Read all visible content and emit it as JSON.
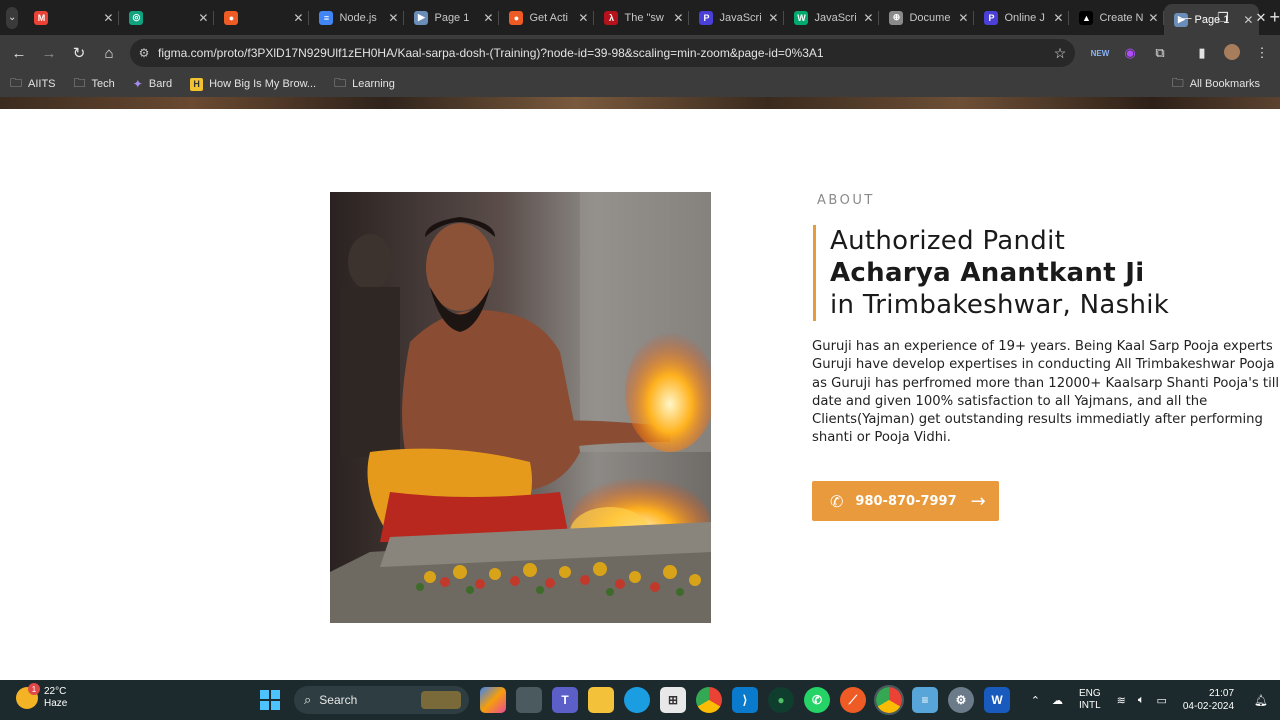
{
  "browser": {
    "tabs": [
      {
        "title": "",
        "icon": "gmail-icon",
        "color": "#ea4335",
        "glyph": "M"
      },
      {
        "title": "",
        "icon": "chatgpt-icon",
        "color": "#10a37f",
        "glyph": "◎"
      },
      {
        "title": "",
        "icon": "postman-icon",
        "color": "#ef5b25",
        "glyph": "●"
      },
      {
        "title": "Node.js",
        "icon": "docs-icon",
        "color": "#4285f4",
        "glyph": "≡"
      },
      {
        "title": "Page 1",
        "icon": "figma-play-icon",
        "color": "#6b8eb8",
        "glyph": "▶"
      },
      {
        "title": "Get Acti",
        "icon": "postman-icon",
        "color": "#ef5b25",
        "glyph": "●"
      },
      {
        "title": "The \"sw",
        "icon": "w3-icon",
        "color": "#b5121b",
        "glyph": "λ"
      },
      {
        "title": "JavaScri",
        "icon": "js-icon",
        "color": "#4a3fd6",
        "glyph": "P"
      },
      {
        "title": "JavaScri",
        "icon": "w3schools-icon",
        "color": "#04aa6d",
        "glyph": "W"
      },
      {
        "title": "Docume",
        "icon": "globe-icon",
        "color": "#8a8a8a",
        "glyph": "⊕"
      },
      {
        "title": "Online J",
        "icon": "js-icon",
        "color": "#4a3fd6",
        "glyph": "P"
      },
      {
        "title": "Create N",
        "icon": "vercel-icon",
        "color": "#000000",
        "glyph": "▲"
      },
      {
        "title": "Page 1",
        "icon": "figma-play-icon",
        "color": "#6b8eb8",
        "glyph": "▶",
        "active": true
      }
    ],
    "url": "figma.com/proto/f3PXlD17N929Ulf1zEH0HA/Kaal-sarpa-dosh-(Training)?node-id=39-98&scaling=min-zoom&page-id=0%3A1",
    "bookmarks": [
      {
        "label": "AIITS",
        "icon": "folder-icon"
      },
      {
        "label": "Tech",
        "icon": "folder-icon"
      },
      {
        "label": "Bard",
        "icon": "bard-icon"
      },
      {
        "label": "How Big Is My Brow...",
        "icon": "hbimb-icon"
      },
      {
        "label": "Learning",
        "icon": "folder-icon"
      }
    ],
    "all_bookmarks": "All Bookmarks"
  },
  "about": {
    "eyebrow": "ABOUT",
    "heading_line1": "Authorized Pandit",
    "heading_line2": "Acharya Anantkant Ji",
    "heading_line3": "in Trimbakeshwar, Nashik",
    "description": "Guruji has an experience of 19+ years. Being Kaal Sarp Pooja experts Guruji have develop expertises in conducting All Trimbakeshwar Pooja as Guruji has perfromed more than 12000+ Kaalsarp Shanti Pooja's till date and given 100% satisfaction to all Yajmans, and all the Clients(Yajman) get outstanding results immediatly after performing shanti or Pooja Vidhi.",
    "phone": "980-870-7997",
    "accent_color": "#e89a3c"
  },
  "taskbar": {
    "weather_temp": "22°C",
    "weather_desc": "Haze",
    "weather_badge": "1",
    "search_label": "Search",
    "lang1": "ENG",
    "lang2": "INTL",
    "time": "21:07",
    "date": "04-02-2024"
  }
}
